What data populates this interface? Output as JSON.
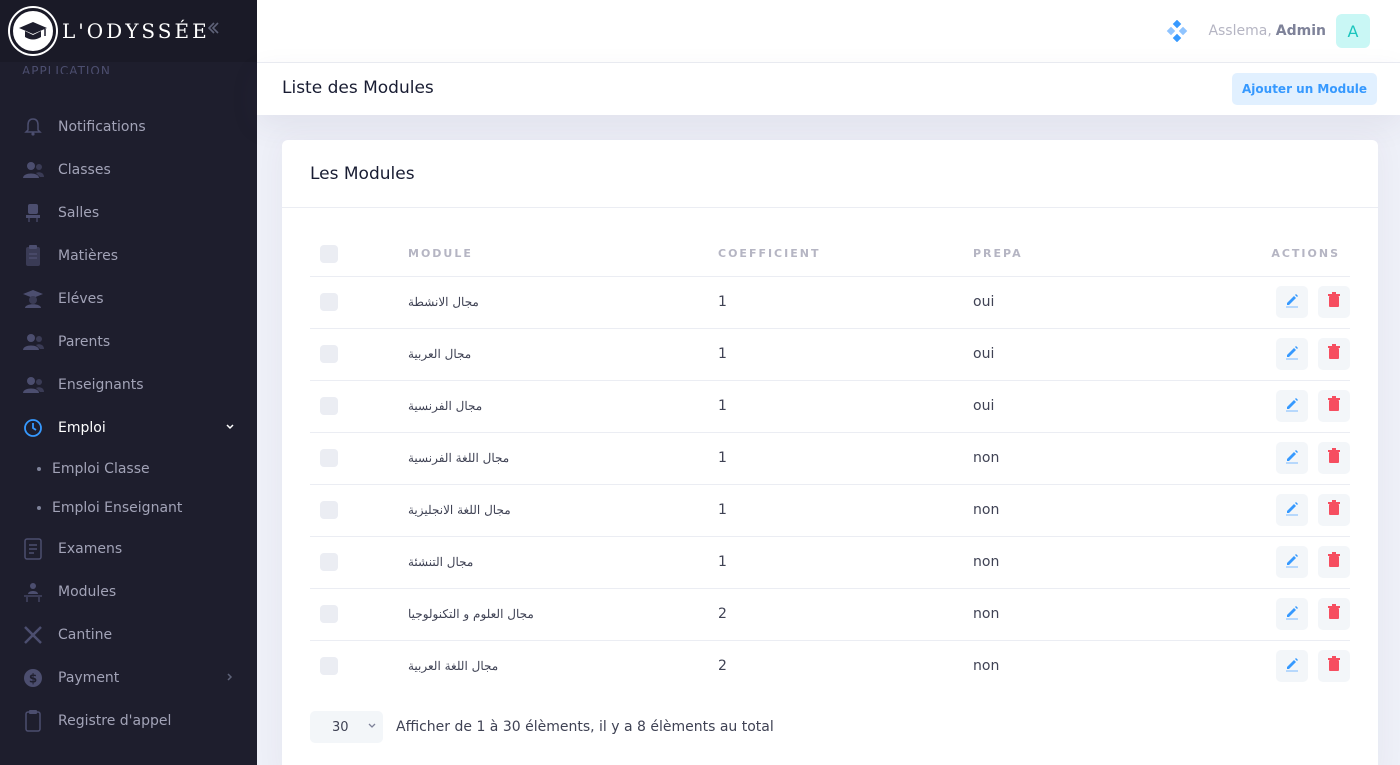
{
  "brand": {
    "name": "L'ODYSSÉE"
  },
  "sidebar": {
    "section_label": "APPLICATION",
    "items": [
      {
        "label": "Notifications",
        "icon": "bell-icon"
      },
      {
        "label": "Classes",
        "icon": "users-icon"
      },
      {
        "label": "Salles",
        "icon": "chair-icon"
      },
      {
        "label": "Matières",
        "icon": "book-icon"
      },
      {
        "label": "Eléves",
        "icon": "student-icon"
      },
      {
        "label": "Parents",
        "icon": "parents-icon"
      },
      {
        "label": "Enseignants",
        "icon": "teachers-icon"
      },
      {
        "label": "Emploi",
        "icon": "clock-icon",
        "expanded": true
      },
      {
        "label": "Examens",
        "icon": "exam-icon"
      },
      {
        "label": "Modules",
        "icon": "modules-icon"
      },
      {
        "label": "Cantine",
        "icon": "cutlery-icon"
      },
      {
        "label": "Payment",
        "icon": "dollar-icon"
      },
      {
        "label": "Registre d'appel",
        "icon": "register-icon"
      }
    ],
    "emploi_sub": [
      "Emploi Classe",
      "Emploi Enseignant"
    ]
  },
  "header": {
    "greeting": "Asslema,",
    "user_name": "Admin",
    "avatar_letter": "A"
  },
  "subheader": {
    "title": "Liste des Modules",
    "add_button": "Ajouter un Module"
  },
  "card": {
    "title": "Les Modules",
    "columns": [
      "MODULE",
      "COEFFICIENT",
      "PREPA",
      "ACTIONS"
    ],
    "rows": [
      {
        "module": "مجال الانشطة",
        "coefficient": "1",
        "prepa": "oui"
      },
      {
        "module": "مجال العربية",
        "coefficient": "1",
        "prepa": "oui"
      },
      {
        "module": "مجال الفرنسية",
        "coefficient": "1",
        "prepa": "oui"
      },
      {
        "module": "مجال اللغة الفرنسية",
        "coefficient": "1",
        "prepa": "non"
      },
      {
        "module": "مجال اللغة الانجليزية",
        "coefficient": "1",
        "prepa": "non"
      },
      {
        "module": "مجال التنشئة",
        "coefficient": "1",
        "prepa": "non"
      },
      {
        "module": "مجال العلوم و التكنولوجيا",
        "coefficient": "2",
        "prepa": "non"
      },
      {
        "module": "مجال اللغة العربية",
        "coefficient": "2",
        "prepa": "non"
      }
    ]
  },
  "pagination": {
    "page_size": "30",
    "info": "Afficher de 1 à 30 élèments, il y a 8 élèments au total"
  },
  "colors": {
    "sidebar_bg": "#1e1e2d",
    "accent_blue": "#3699ff",
    "danger": "#f64e60",
    "avatar_bg": "#c9f7f5",
    "avatar_fg": "#1bc5bd"
  }
}
